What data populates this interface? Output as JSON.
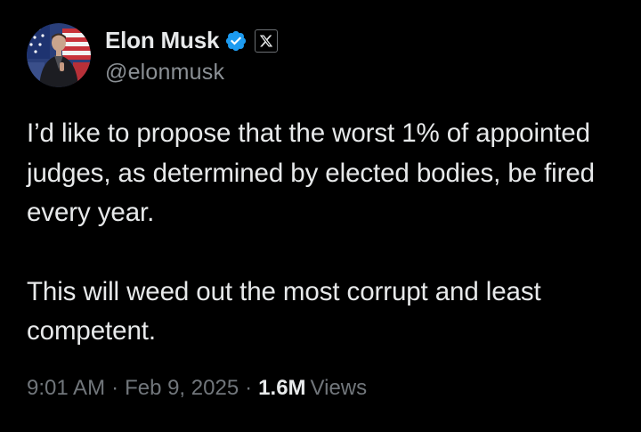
{
  "author": {
    "display_name": "Elon Musk",
    "handle": "@elonmusk",
    "verified_icon": "verified-badge-icon",
    "affiliate_icon": "x-logo-icon"
  },
  "tweet": {
    "paragraphs": [
      "I’d like to propose that the worst 1% of appointed judges, as determined by elected bodies, be fired every year.",
      "This will weed out the most corrupt and least competent."
    ]
  },
  "meta": {
    "time": "9:01 AM",
    "separator": "·",
    "date": "Feb 9, 2025",
    "views_count": "1.6M",
    "views_label": "Views"
  },
  "colors": {
    "background": "#000000",
    "text_primary": "#e7e9ea",
    "text_secondary": "#71767b",
    "verified_blue": "#1d9bf0"
  }
}
